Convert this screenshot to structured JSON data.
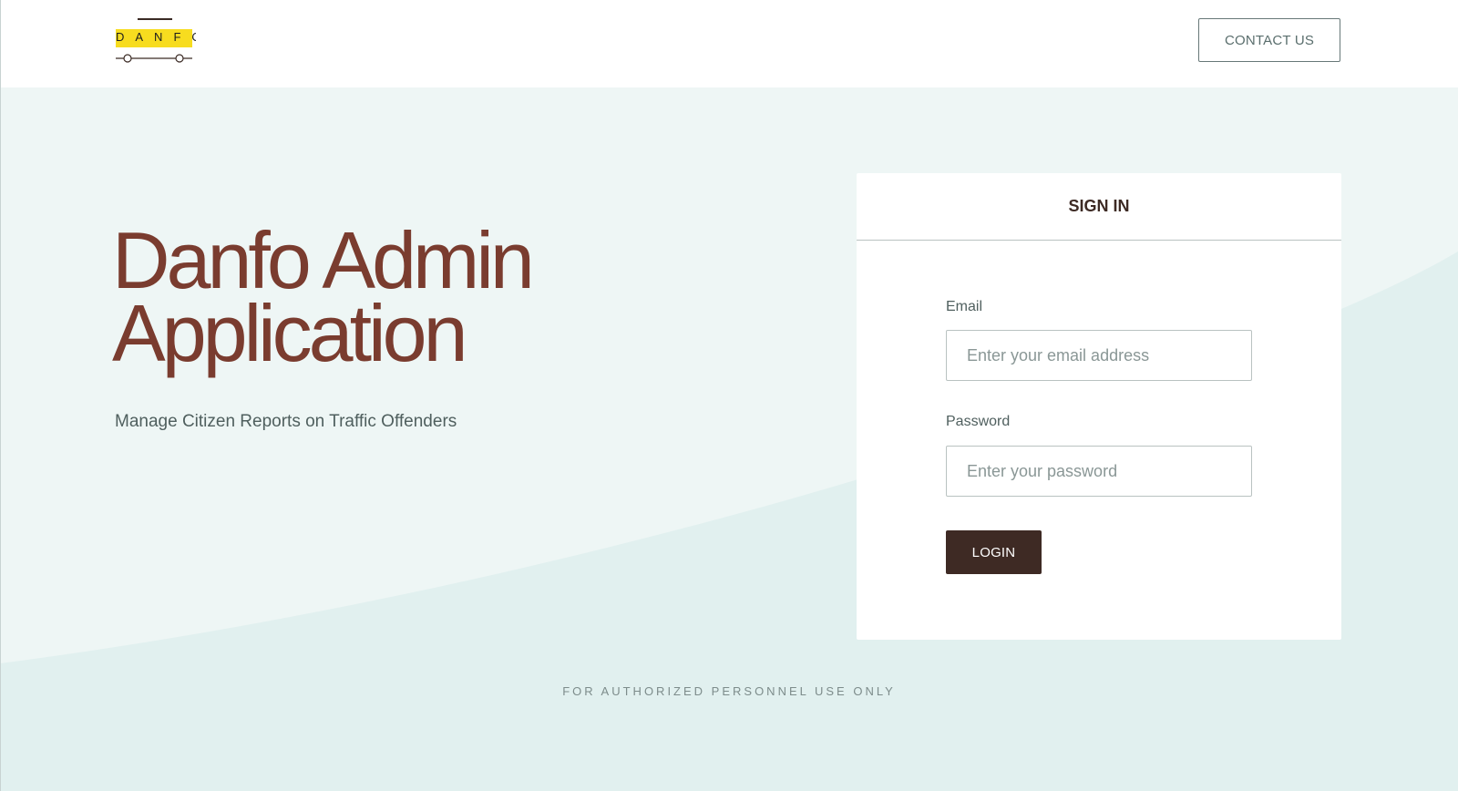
{
  "header": {
    "logo_text": "DANFO",
    "contact_label": "CONTACT US"
  },
  "hero": {
    "title_line1": "Danfo Admin",
    "title_line2": "Application",
    "subtitle": "Manage Citizen Reports on Traffic Offenders"
  },
  "signin": {
    "heading": "SIGN IN",
    "email_label": "Email",
    "email_placeholder": "Enter your email address",
    "email_value": "",
    "password_label": "Password",
    "password_placeholder": "Enter your password",
    "password_value": "",
    "login_label": "LOGIN"
  },
  "footer": {
    "note": "FOR AUTHORIZED PERSONNEL USE ONLY"
  },
  "colors": {
    "background": "#eef6f5",
    "wave": "#e1f0ef",
    "title": "#7a3c2f",
    "logo_band": "#f7dc1f",
    "button_dark": "#3e2a24"
  },
  "icons": {
    "logo": "danfo-bus-logo-icon"
  }
}
